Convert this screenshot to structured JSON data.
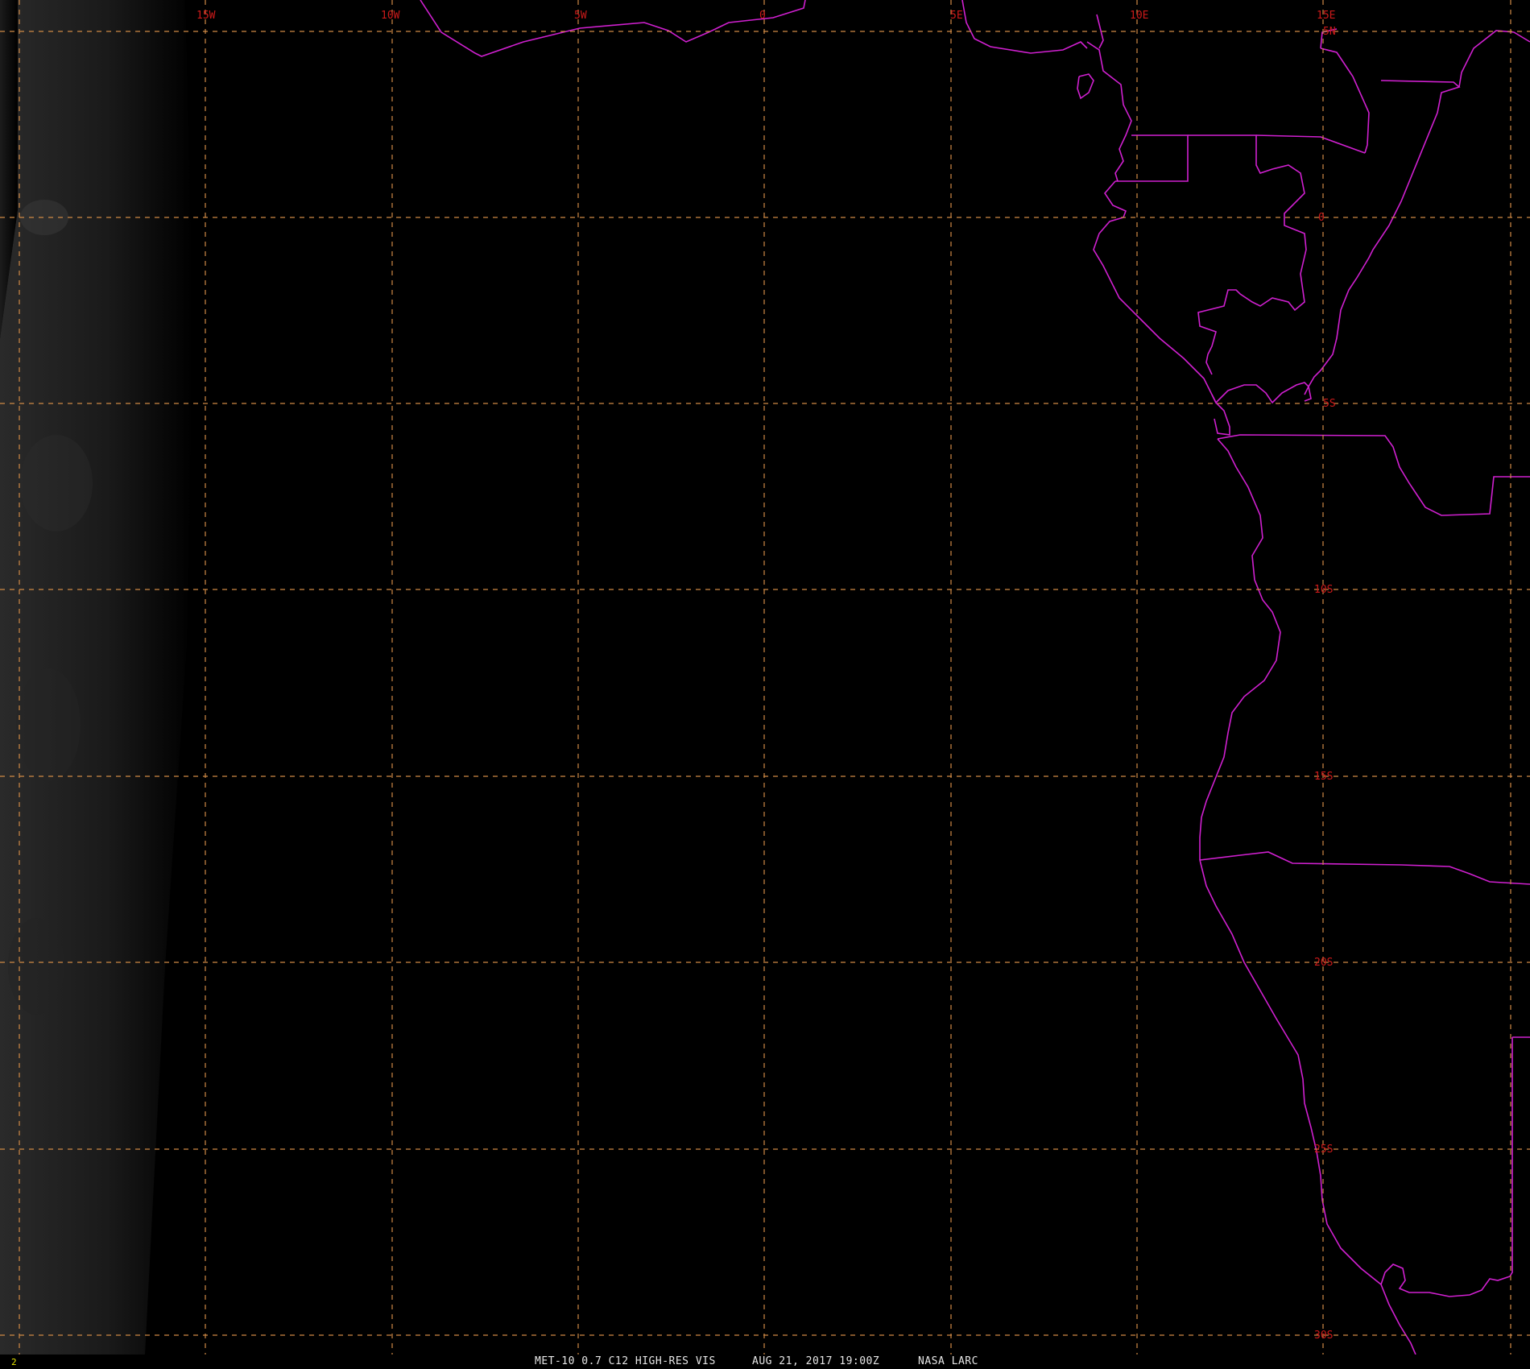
{
  "footer": {
    "frame_number": "2",
    "satellite": "MET-10 0.7 C12 HIGH-RES VIS",
    "datetime": "AUG 21, 2017 19:00Z",
    "source": "NASA LARC"
  },
  "grid": {
    "longitude_labels": [
      "15W",
      "10W",
      "5W",
      "0",
      "5E",
      "10E",
      "15E"
    ],
    "latitude_labels": [
      "5N",
      "0",
      "5S",
      "10S",
      "15S",
      "20S",
      "25S",
      "30S"
    ]
  },
  "colors": {
    "grid_line": "#d08a45",
    "grid_label": "#cc1a1a",
    "coastline": "#d020d0",
    "background": "#000000",
    "footer_text": "#e6e6e6",
    "frame_number": "#e8e800"
  }
}
